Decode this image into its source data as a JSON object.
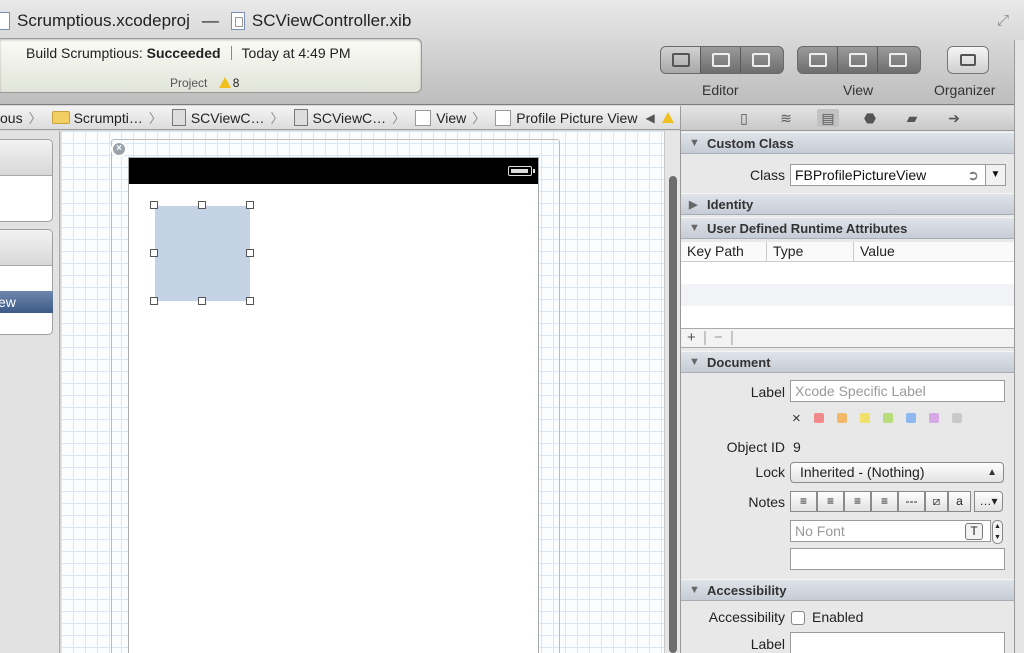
{
  "window": {
    "project_name": "Scrumptious.xcodeproj",
    "separator": "—",
    "file_name": "SCViewController.xib"
  },
  "activity": {
    "prefix": "Build Scrumptious:",
    "status": "Succeeded",
    "time": "Today at 4:49 PM",
    "sub_label": "Project",
    "warning_count": "8"
  },
  "toolbar": {
    "editor_label": "Editor",
    "view_label": "View",
    "organizer_label": "Organizer"
  },
  "jumpbar": {
    "items": [
      "ous",
      "Scrumpti…",
      "SCViewC…",
      "SCViewC…",
      "View",
      "Profile Picture View"
    ]
  },
  "outline": {
    "selected_fragment": "ew"
  },
  "inspector": {
    "custom_class": {
      "title": "Custom Class",
      "class_label": "Class",
      "class_value": "FBProfilePictureView"
    },
    "identity": {
      "title": "Identity"
    },
    "runtime_attrs": {
      "title": "User Defined Runtime Attributes",
      "columns": [
        "Key Path",
        "Type",
        "Value"
      ],
      "add": "+",
      "remove": "−"
    },
    "document": {
      "title": "Document",
      "label_label": "Label",
      "label_placeholder": "Xcode Specific Label",
      "clear_color": "×",
      "object_id_label": "Object ID",
      "object_id_value": "9",
      "lock_label": "Lock",
      "lock_value": "Inherited - (Nothing)",
      "notes_label": "Notes",
      "font_placeholder": "No Font",
      "label_colors": [
        "#f08a8a",
        "#f4b86a",
        "#f1e06a",
        "#b9dc7a",
        "#8fb8f0",
        "#d6a8e6",
        "#c9c9c9"
      ]
    },
    "accessibility": {
      "title": "Accessibility",
      "accessibility_label": "Accessibility",
      "enabled_label": "Enabled",
      "label_label": "Label"
    }
  },
  "colors": {
    "selection": "#3c5a88",
    "profile_view": "#c4d2e6",
    "warning": "#f0c020"
  }
}
